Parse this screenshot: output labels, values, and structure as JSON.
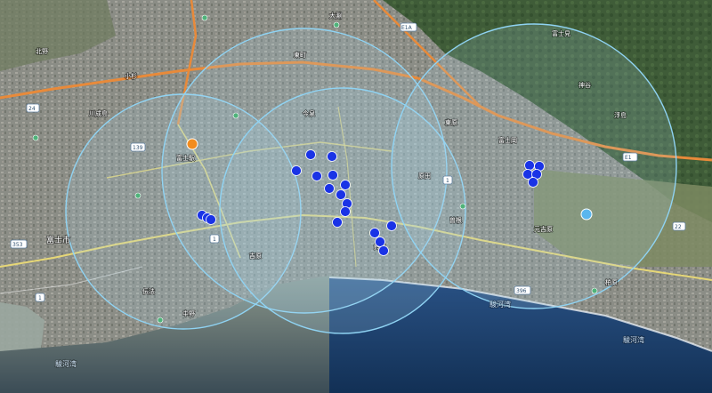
{
  "place_labels": [
    {
      "id": "fuji-city",
      "text": "富士市"
    },
    {
      "id": "fuji-sta",
      "text": "富士駅"
    },
    {
      "id": "suruga-bay-1",
      "text": "駿河湾"
    },
    {
      "id": "suruga-bay-2",
      "text": "駿河湾"
    },
    {
      "id": "suruga-bay-3",
      "text": "駿河湾"
    },
    {
      "id": "fujimi",
      "text": "富士見"
    },
    {
      "id": "kanbara",
      "text": "神谷"
    },
    {
      "id": "higashi",
      "text": "東町"
    },
    {
      "id": "yoshiwara",
      "text": "吉原"
    },
    {
      "id": "kawanari",
      "text": "川成島"
    },
    {
      "id": "suzukawa",
      "text": "鈴川"
    },
    {
      "id": "denbo",
      "text": "伝法"
    },
    {
      "id": "imaizumi",
      "text": "今泉"
    },
    {
      "id": "nakano",
      "text": "中野"
    },
    {
      "id": "higashihara",
      "text": "東原"
    },
    {
      "id": "sone",
      "text": "曽根"
    },
    {
      "id": "fujioka",
      "text": "富士岡"
    },
    {
      "id": "kitano",
      "text": "北野"
    },
    {
      "id": "ukishima",
      "text": "浮島"
    },
    {
      "id": "motoyoshiwara",
      "text": "元吉原"
    },
    {
      "id": "kashiwabara",
      "text": "柏原"
    },
    {
      "id": "kosugi",
      "text": "小杉"
    },
    {
      "id": "harada",
      "text": "原田"
    },
    {
      "id": "ohashi",
      "text": "大淵"
    }
  ],
  "road_shields": [
    {
      "id": "r139",
      "text": "139"
    },
    {
      "id": "r1a",
      "text": "1"
    },
    {
      "id": "r1b",
      "text": "1"
    },
    {
      "id": "r1c",
      "text": "1"
    },
    {
      "id": "e1a",
      "text": "E1A"
    },
    {
      "id": "e1",
      "text": "E1"
    },
    {
      "id": "r22",
      "text": "22"
    },
    {
      "id": "r24",
      "text": "24"
    },
    {
      "id": "r353",
      "text": "353"
    },
    {
      "id": "r396",
      "text": "396"
    }
  ],
  "radius_circles": [
    {
      "id": "circle-west"
    },
    {
      "id": "circle-north"
    },
    {
      "id": "circle-center"
    },
    {
      "id": "circle-east"
    }
  ],
  "markers": [
    {
      "id": "orange",
      "color": "#f28c1e",
      "kind": "highlight"
    },
    {
      "id": "lightblue",
      "color": "#5ab6ee",
      "kind": "secondary"
    },
    {
      "id": "blue",
      "color": "#1a33e6",
      "kind": "point"
    }
  ],
  "colors": {
    "circle_stroke": "#8fd3f3",
    "circle_fill": "rgba(170,215,240,0.18)",
    "expressway": "#e88a3a",
    "national_road": "#e6d777",
    "coast_water": "#264a78",
    "mountains": "#3c5a36"
  }
}
